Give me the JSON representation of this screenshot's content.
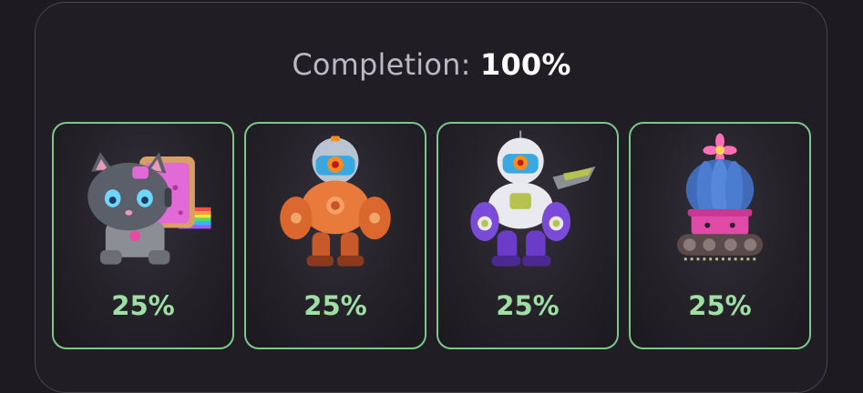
{
  "completion": {
    "label": "Completion:",
    "value": "100%"
  },
  "cards": [
    {
      "icon": "robot-cat-icon",
      "percent": "25%"
    },
    {
      "icon": "orange-mech-robot-icon",
      "percent": "25%"
    },
    {
      "icon": "purple-mech-robot-icon",
      "percent": "25%"
    },
    {
      "icon": "cactus-tank-icon",
      "percent": "25%"
    }
  ],
  "colors": {
    "accent_green": "#7cc88a",
    "percent_text": "#9ee0a4",
    "background": "#1d1a20"
  }
}
